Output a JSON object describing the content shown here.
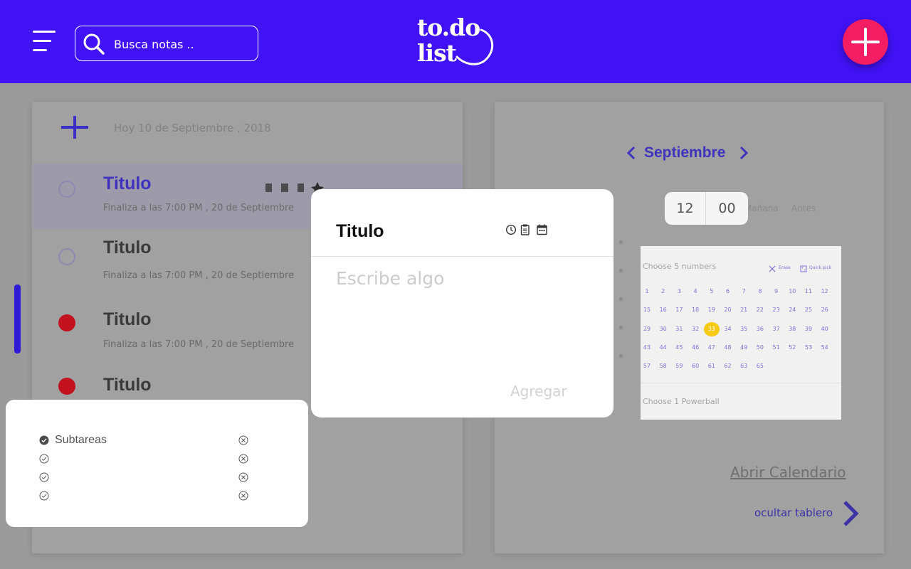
{
  "header": {
    "search_placeholder": "Busca notas ..",
    "logo_line1": "to.do",
    "logo_line2": "list"
  },
  "board": {
    "date_text": "Hoy 10 de Septiembre , 2018",
    "tasks": [
      {
        "title": "Titulo",
        "subtitle": "Finaliza a las 7:00 PM , 20 de Septiembre",
        "status": "pending",
        "active": true
      },
      {
        "title": "Titulo",
        "subtitle": "Finaliza a las 7:00 PM , 20 de Septiembre",
        "status": "pending",
        "active": false
      },
      {
        "title": "Titulo",
        "subtitle": "Finaliza a las 7:00 PM , 20 de Septiembre",
        "status": "urgent",
        "active": false
      },
      {
        "title": "Titulo",
        "subtitle": "",
        "status": "urgent",
        "active": false
      }
    ]
  },
  "calendar": {
    "month": "Septiembre",
    "ghost_labels": [
      "Mañana",
      "Antes"
    ],
    "open_calendar": "Abrir Calendario",
    "hide_board": "ocultar tablero"
  },
  "time_picker": {
    "hour": "12",
    "minute": "00"
  },
  "number_picker": {
    "title": "Choose 5 numbers",
    "erase_label": "Erase",
    "quick_pick_label": "Quick pick",
    "numbers": [
      "1",
      "2",
      "3",
      "4",
      "5",
      "6",
      "7",
      "8",
      "9",
      "10",
      "11",
      "12",
      "15",
      "16",
      "17",
      "18",
      "19",
      "20",
      "21",
      "22",
      "23",
      "24",
      "25",
      "26",
      "29",
      "30",
      "31",
      "32",
      "33",
      "34",
      "35",
      "36",
      "37",
      "38",
      "39",
      "40",
      "43",
      "44",
      "45",
      "46",
      "47",
      "48",
      "49",
      "50",
      "51",
      "52",
      "53",
      "54",
      "57",
      "58",
      "59",
      "60",
      "61",
      "62",
      "63",
      "65"
    ],
    "selected": "33",
    "powerball_title": "Choose 1 Powerball"
  },
  "subtasks": {
    "items": [
      {
        "label": "Subtareas",
        "checked": true
      },
      {
        "label": "",
        "checked": false
      },
      {
        "label": "",
        "checked": false
      },
      {
        "label": "",
        "checked": false
      }
    ]
  },
  "note_modal": {
    "title": "Titulo",
    "placeholder": "Escribe algo",
    "add_label": "Agregar"
  },
  "colors": {
    "header": "#4012f5",
    "fab": "#f31d63",
    "selected_number": "#f6c913",
    "urgent": "#c2121e"
  }
}
